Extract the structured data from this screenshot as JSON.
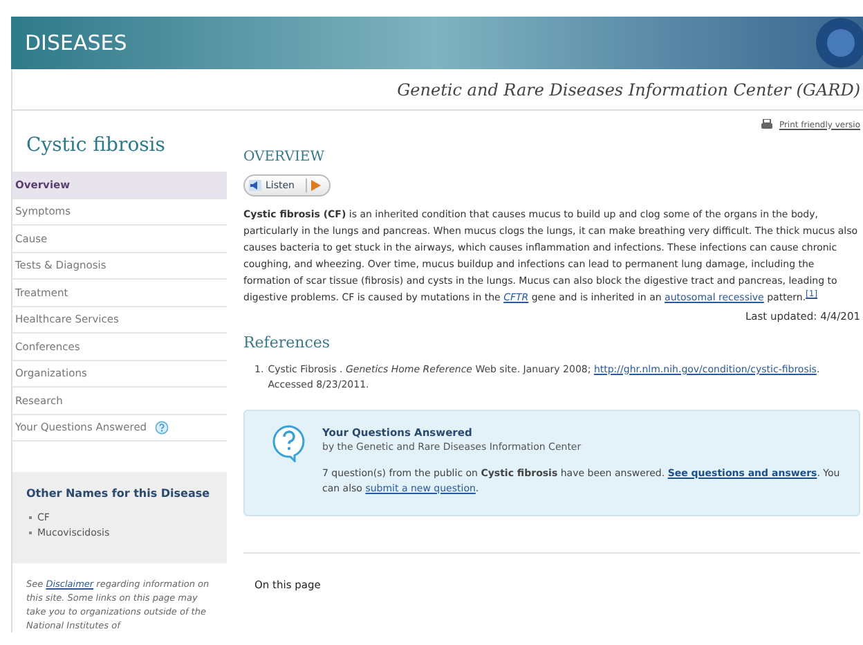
{
  "banner": {
    "title": "DISEASES"
  },
  "site_name": "Genetic and Rare Diseases Information Center (GARD)",
  "print_link": "Print friendly versio",
  "disease_title": "Cystic fibrosis",
  "sidebar": {
    "items": [
      {
        "label": "Overview",
        "selected": true
      },
      {
        "label": "Symptoms",
        "selected": false
      },
      {
        "label": "Cause",
        "selected": false
      },
      {
        "label": "Tests & Diagnosis",
        "selected": false
      },
      {
        "label": "Treatment",
        "selected": false
      },
      {
        "label": "Healthcare Services",
        "selected": false
      },
      {
        "label": "Conferences",
        "selected": false
      },
      {
        "label": "Organizations",
        "selected": false
      },
      {
        "label": "Research",
        "selected": false
      },
      {
        "label": "Your Questions Answered",
        "selected": false,
        "help": true
      }
    ],
    "other_names": {
      "title": "Other Names for this Disease",
      "items": [
        "CF",
        "Mucoviscidosis"
      ]
    },
    "disclaimer": [
      {
        "kind": "text",
        "text": "See "
      },
      {
        "kind": "link",
        "text": "Disclaimer"
      },
      {
        "kind": "text",
        "text": " regarding information on this site. Some links on this page may take you to organizations outside of the National Institutes of"
      }
    ]
  },
  "overview": {
    "heading": "OVERVIEW",
    "listen": "Listen",
    "paragraph": [
      {
        "kind": "bold",
        "text": "Cystic fibrosis (CF)"
      },
      {
        "kind": "text",
        "text": " is an inherited condition that causes mucus to build up and clog some of the organs in the body, particularly in the lungs and pancreas. When mucus clogs the lungs, it can make breathing very difficult. The thick mucus also causes bacteria to get stuck in the airways, which causes inflammation and infections. These infections can cause chronic coughing, and wheezing. Over time, mucus buildup and infections can lead to permanent lung damage, including the formation of scar tissue (fibrosis) and cysts in the lungs. Mucus can also block the digestive tract and pancreas, leading to digestive problems. CF is caused by mutations in the "
      },
      {
        "kind": "italic-link",
        "text": "CFTR"
      },
      {
        "kind": "text",
        "text": " gene and is inherited in an "
      },
      {
        "kind": "link",
        "text": "autosomal recessive"
      },
      {
        "kind": "text",
        "text": " pattern."
      },
      {
        "kind": "sup-link",
        "text": "[1]"
      }
    ],
    "last_updated": "Last updated: 4/4/201"
  },
  "references": {
    "heading": "References",
    "items": [
      {
        "number": "1.",
        "segments": [
          {
            "kind": "text",
            "text": "Cystic Fibrosis . "
          },
          {
            "kind": "italic",
            "text": "Genetics Home Reference"
          },
          {
            "kind": "text",
            "text": " Web site. January 2008; "
          },
          {
            "kind": "link",
            "text": "http://ghr.nlm.nih.gov/condition/cystic-fibrosis"
          },
          {
            "kind": "text",
            "text": ". Accessed 8/23/2011."
          }
        ]
      }
    ]
  },
  "questions_box": {
    "title": "Your Questions Answered",
    "subtitle": "by the Genetic and Rare Diseases Information Center",
    "text": [
      {
        "kind": "text",
        "text": "7 question(s) from the public on "
      },
      {
        "kind": "bold",
        "text": "Cystic fibrosis"
      },
      {
        "kind": "text",
        "text": " have been answered. "
      },
      {
        "kind": "bold-link",
        "text": "See questions and answers"
      },
      {
        "kind": "text",
        "text": ". You can also "
      },
      {
        "kind": "link",
        "text": "submit a new question"
      },
      {
        "kind": "text",
        "text": "."
      }
    ]
  },
  "on_this_page": "On this page"
}
